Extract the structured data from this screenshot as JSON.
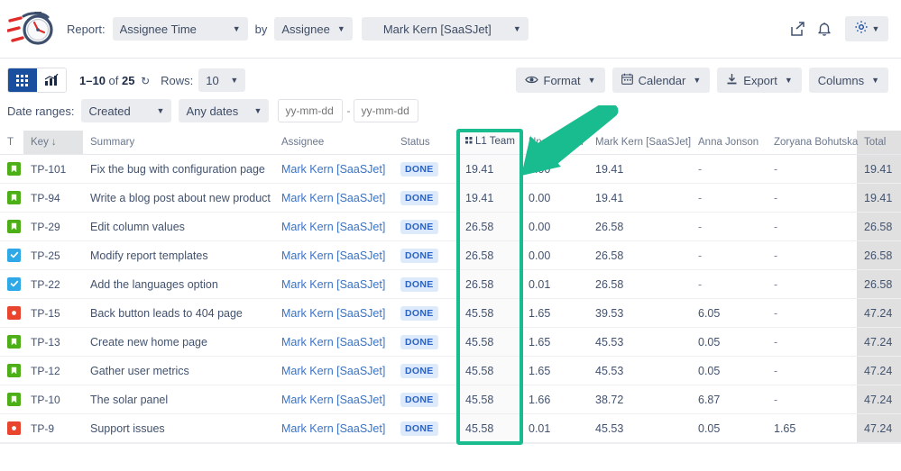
{
  "header": {
    "logo_icon": "flying-stopwatch-logo",
    "report_label": "Report:",
    "report_select": "Assignee Time",
    "by_label": "by",
    "group_select": "Assignee",
    "user_select": "Mark Kern [SaaSJet]",
    "share_icon": "share-icon",
    "bell_icon": "bell-icon",
    "gear_icon": "gear-icon",
    "chevron_icon": "chevron-down-icon"
  },
  "toolbar": {
    "grid_view_icon": "grid-view-icon",
    "chart_view_icon": "chart-view-icon",
    "pagination_range": "1–10",
    "pagination_of": "of",
    "pagination_total": "25",
    "refresh_icon": "refresh-icon",
    "rows_label": "Rows:",
    "rows_value": "10",
    "date_ranges_label": "Date ranges:",
    "date_field": "Created",
    "date_preset": "Any dates",
    "date_from_placeholder": "yy-mm-dd",
    "date_to_placeholder": "yy-mm-dd",
    "date_separator": "-",
    "format_button": "Format",
    "format_icon": "eye-icon",
    "calendar_button": "Calendar",
    "calendar_icon": "calendar-icon",
    "export_button": "Export",
    "export_icon": "download-icon",
    "columns_button": "Columns"
  },
  "table": {
    "columns": [
      {
        "key": "t",
        "label": "T",
        "sorted": false
      },
      {
        "key": "key",
        "label": "Key",
        "sorted": true,
        "sort_icon": "sort-down-arrow"
      },
      {
        "key": "sum",
        "label": "Summary",
        "sorted": false
      },
      {
        "key": "asg",
        "label": "Assignee",
        "sorted": false
      },
      {
        "key": "status",
        "label": "Status",
        "sorted": false
      },
      {
        "key": "l1",
        "label": "L1 Team",
        "sorted": false,
        "icon": "team-grid-icon"
      },
      {
        "key": "unas",
        "label": "Unassigned",
        "sorted": false
      },
      {
        "key": "mark",
        "label": "Mark Kern [SaaSJet]",
        "sorted": false
      },
      {
        "key": "anna",
        "label": "Anna Jonson",
        "sorted": false
      },
      {
        "key": "zoryana",
        "label": "Zoryana Bohutska",
        "sorted": false
      },
      {
        "key": "total",
        "label": "Total",
        "sorted": false
      }
    ],
    "rows": [
      {
        "type": "story",
        "key": "TP-101",
        "summary": "Fix the bug with configuration page",
        "assignee": "Mark Kern [SaaSJet]",
        "status": "DONE",
        "l1": "19.41",
        "unassigned": "0.00",
        "mark": "19.41",
        "anna": "-",
        "zoryana": "-",
        "total": "19.41"
      },
      {
        "type": "story",
        "key": "TP-94",
        "summary": "Write a blog post about new product",
        "assignee": "Mark Kern [SaaSJet]",
        "status": "DONE",
        "l1": "19.41",
        "unassigned": "0.00",
        "mark": "19.41",
        "anna": "-",
        "zoryana": "-",
        "total": "19.41"
      },
      {
        "type": "story",
        "key": "TP-29",
        "summary": "Edit column values",
        "assignee": "Mark Kern [SaaSJet]",
        "status": "DONE",
        "l1": "26.58",
        "unassigned": "0.00",
        "mark": "26.58",
        "anna": "-",
        "zoryana": "-",
        "total": "26.58"
      },
      {
        "type": "task",
        "key": "TP-25",
        "summary": "Modify report templates",
        "assignee": "Mark Kern [SaaSJet]",
        "status": "DONE",
        "l1": "26.58",
        "unassigned": "0.00",
        "mark": "26.58",
        "anna": "-",
        "zoryana": "-",
        "total": "26.58"
      },
      {
        "type": "task",
        "key": "TP-22",
        "summary": "Add the languages option",
        "assignee": "Mark Kern [SaaSJet]",
        "status": "DONE",
        "l1": "26.58",
        "unassigned": "0.01",
        "mark": "26.58",
        "anna": "-",
        "zoryana": "-",
        "total": "26.58"
      },
      {
        "type": "bug",
        "key": "TP-15",
        "summary": "Back button leads to 404 page",
        "assignee": "Mark Kern [SaaSJet]",
        "status": "DONE",
        "l1": "45.58",
        "unassigned": "1.65",
        "mark": "39.53",
        "anna": "6.05",
        "zoryana": "-",
        "total": "47.24"
      },
      {
        "type": "story",
        "key": "TP-13",
        "summary": "Create new home page",
        "assignee": "Mark Kern [SaaSJet]",
        "status": "DONE",
        "l1": "45.58",
        "unassigned": "1.65",
        "mark": "45.53",
        "anna": "0.05",
        "zoryana": "-",
        "total": "47.24"
      },
      {
        "type": "story",
        "key": "TP-12",
        "summary": "Gather user metrics",
        "assignee": "Mark Kern [SaaSJet]",
        "status": "DONE",
        "l1": "45.58",
        "unassigned": "1.65",
        "mark": "45.53",
        "anna": "0.05",
        "zoryana": "-",
        "total": "47.24"
      },
      {
        "type": "story",
        "key": "TP-10",
        "summary": "The solar panel",
        "assignee": "Mark Kern [SaaSJet]",
        "status": "DONE",
        "l1": "45.58",
        "unassigned": "1.66",
        "mark": "38.72",
        "anna": "6.87",
        "zoryana": "-",
        "total": "47.24"
      },
      {
        "type": "bug",
        "key": "TP-9",
        "summary": "Support issues",
        "assignee": "Mark Kern [SaaSJet]",
        "status": "DONE",
        "l1": "45.58",
        "unassigned": "0.01",
        "mark": "45.53",
        "anna": "0.05",
        "zoryana": "1.65",
        "total": "47.24"
      }
    ]
  },
  "annotations": {
    "highlight_color": "#18bc8e",
    "highlight_target": "L1 Team",
    "arrow_icon": "pointer-arrow",
    "arrow_target": "L1 Team column"
  },
  "colors": {
    "accent_blue": "#1a4fa0",
    "link_blue": "#3b73c4",
    "badge_bg": "#dceafc",
    "badge_text": "#2a63c4",
    "story_green": "#4caf17",
    "task_blue": "#2fa8e8",
    "bug_red": "#e8442e",
    "highlight_teal": "#18bc8e",
    "total_col_bg": "#e0e0e0"
  }
}
